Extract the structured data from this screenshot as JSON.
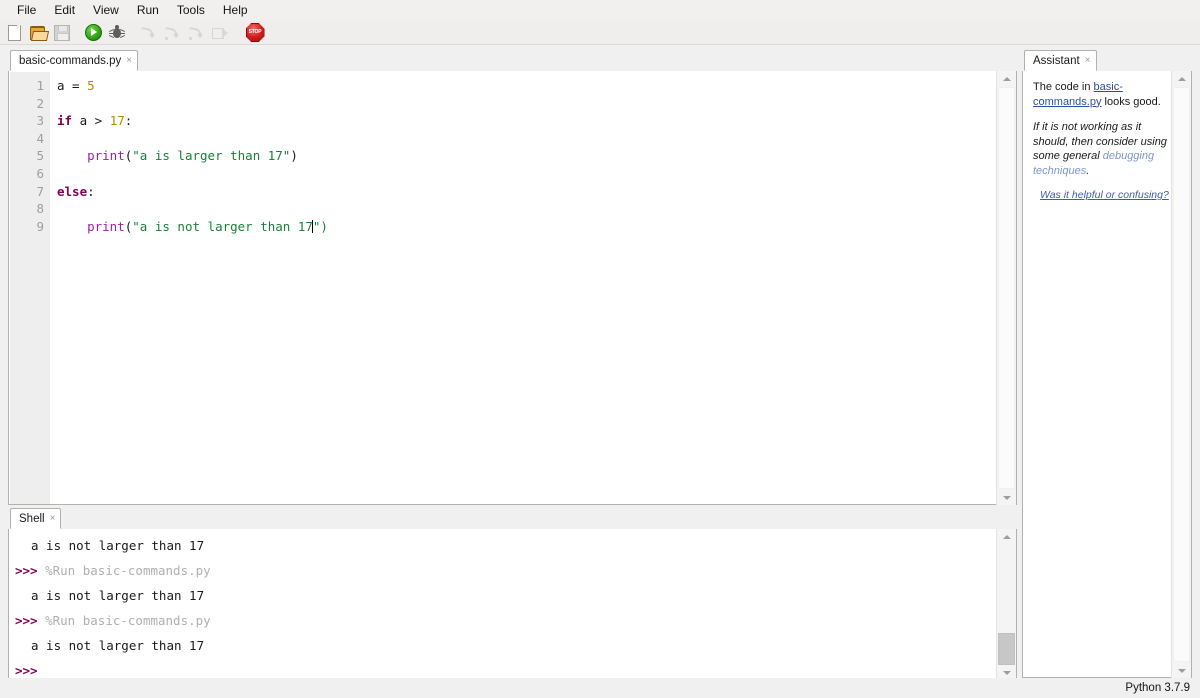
{
  "menubar": {
    "items": [
      {
        "label": "File"
      },
      {
        "label": "Edit"
      },
      {
        "label": "View"
      },
      {
        "label": "Run"
      },
      {
        "label": "Tools"
      },
      {
        "label": "Help"
      }
    ]
  },
  "toolbar": {
    "buttons": [
      {
        "name": "new-file-icon",
        "title": "New",
        "enabled": true
      },
      {
        "name": "open-folder-icon",
        "title": "Load",
        "enabled": true
      },
      {
        "name": "save-icon",
        "title": "Save",
        "enabled": false
      },
      {
        "name": "run-icon",
        "title": "Run current script",
        "enabled": true
      },
      {
        "name": "debug-icon",
        "title": "Debug current script",
        "enabled": true
      },
      {
        "name": "step-over-icon",
        "title": "Step over",
        "enabled": false
      },
      {
        "name": "step-into-icon",
        "title": "Step into",
        "enabled": false
      },
      {
        "name": "step-out-icon",
        "title": "Step out",
        "enabled": false
      },
      {
        "name": "resume-icon",
        "title": "Resume",
        "enabled": false
      },
      {
        "name": "stop-icon",
        "title": "Stop/Restart backend",
        "enabled": true,
        "text": "STOP"
      }
    ]
  },
  "editor": {
    "tab": {
      "label": "basic-commands.py",
      "close": "×"
    },
    "gutter": [
      "1",
      "2",
      "3",
      "4",
      "5",
      "6",
      "7",
      "8",
      "9"
    ],
    "code_lines": [
      {
        "n": 1,
        "text": "a = 5"
      },
      {
        "n": 2,
        "text": ""
      },
      {
        "n": 3,
        "text": "if a > 17:"
      },
      {
        "n": 4,
        "text": ""
      },
      {
        "n": 5,
        "text": "    print(\"a is larger than 17\")"
      },
      {
        "n": 6,
        "text": ""
      },
      {
        "n": 7,
        "text": "else:"
      },
      {
        "n": 8,
        "text": ""
      },
      {
        "n": 9,
        "text": "    print(\"a is not larger than 17\")"
      }
    ],
    "caret": {
      "line": 9,
      "column": 34
    }
  },
  "shell": {
    "tab": {
      "label": "Shell",
      "close": "×"
    },
    "lines": [
      {
        "kind": "output",
        "text": "a is not larger than 17"
      },
      {
        "kind": "command",
        "prompt": ">>>",
        "text": "%Run basic-commands.py"
      },
      {
        "kind": "output",
        "text": "a is not larger than 17"
      },
      {
        "kind": "command",
        "prompt": ">>>",
        "text": "%Run basic-commands.py"
      },
      {
        "kind": "output",
        "text": "a is not larger than 17"
      },
      {
        "kind": "prompt",
        "prompt": ">>>",
        "text": ""
      }
    ]
  },
  "assistant": {
    "tab": {
      "label": "Assistant",
      "close": "×"
    },
    "para1_pre": "The code in ",
    "para1_link": "basic-commands.py",
    "para1_post": " looks good.",
    "para2_pre": "If it is not working as it should, then consider using some general ",
    "para2_link": "debugging techniques",
    "para2_post": ".",
    "feedback_link": "Was it helpful or confusing?"
  },
  "statusbar": {
    "python_version": "Python 3.7.9"
  },
  "colors": {
    "keyword": "#7f0055",
    "string": "#1a7f37",
    "number": "#b8860b",
    "builtin": "#a020a0",
    "link": "#2b4f9e",
    "link_soft": "#7e96c9",
    "run_green": "#31a413",
    "stop_red": "#cf1c1c"
  }
}
